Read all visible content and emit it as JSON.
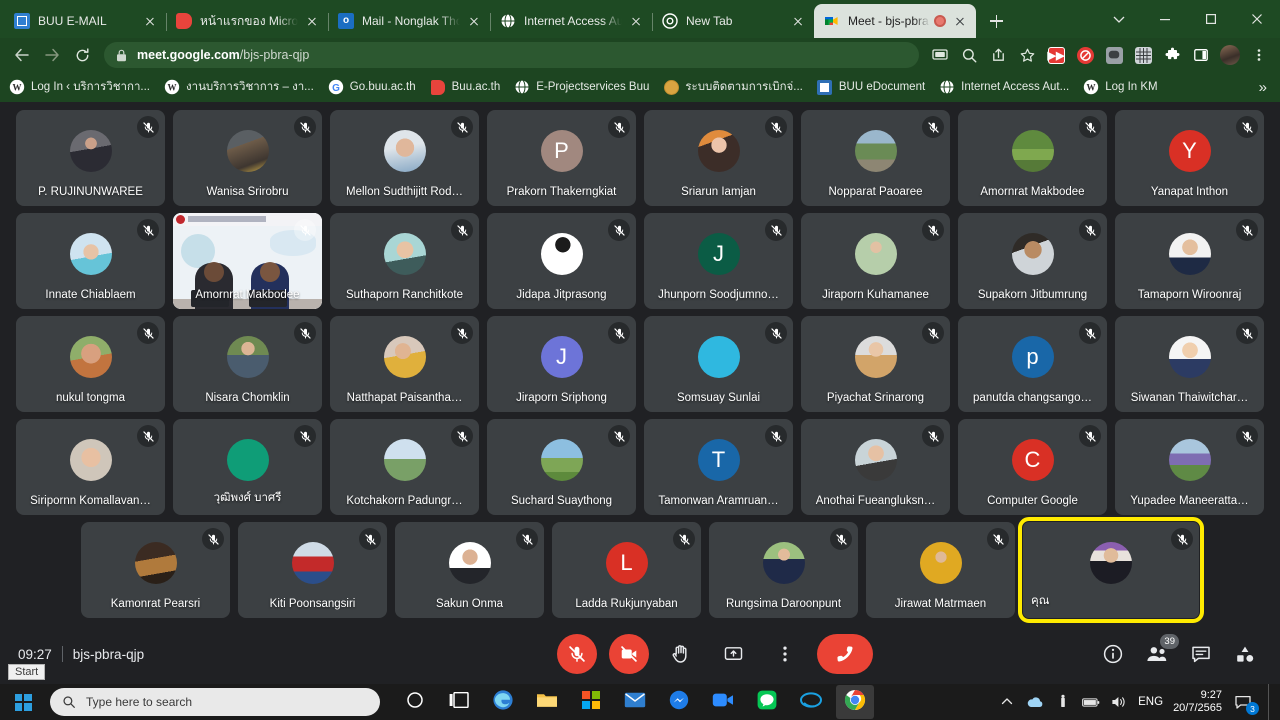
{
  "browser": {
    "tabs": [
      {
        "title": "BUU E-MAIL",
        "favicon": "mail-envelope-icon",
        "favicon_color": "#2f7fd0",
        "active": false,
        "recording": false
      },
      {
        "title": "หน้าแรกของ Microso",
        "favicon": "microsoft-start-icon",
        "favicon_color": "#e8443c",
        "active": false,
        "recording": false
      },
      {
        "title": "Mail - Nonglak Tho",
        "favicon": "outlook-icon",
        "favicon_color": "#1b6ec2",
        "active": false,
        "recording": false
      },
      {
        "title": "Internet Access Aut",
        "favicon": "globe-icon",
        "favicon_color": "#ffffff",
        "active": false,
        "recording": false
      },
      {
        "title": "New Tab",
        "favicon": "chrome-icon",
        "favicon_color": "#ffffff",
        "active": false,
        "recording": false
      },
      {
        "title": "Meet - bjs-pbra",
        "favicon": "google-meet-icon",
        "favicon_color": "#00ac47",
        "active": true,
        "recording": true
      }
    ],
    "new_tab_label": "New tab",
    "window_controls": {
      "minimize": "Minimize",
      "maximize": "Maximize",
      "close": "Close",
      "chevron": "Tab search"
    },
    "nav": {
      "back": "Back",
      "forward": "Forward",
      "reload": "Reload"
    },
    "omnibox": {
      "lock": "site-information-lock-icon",
      "url_domain": "meet.google.com",
      "url_path": "/bjs-pbra-qjp"
    },
    "toolbar_icons": [
      {
        "name": "cast-icon",
        "glyph": "cast"
      },
      {
        "name": "search-icon",
        "glyph": "search"
      },
      {
        "name": "share-icon",
        "glyph": "share"
      },
      {
        "name": "bookmark-star-icon",
        "glyph": "star"
      },
      {
        "name": "extension-video-downloader-icon",
        "glyph": "fwd",
        "color": "#e53935"
      },
      {
        "name": "extension-adblock-icon",
        "glyph": "block",
        "color": "#e53935"
      },
      {
        "name": "extension-line-icon",
        "glyph": "chat",
        "color": "#9aa0a6"
      },
      {
        "name": "extension-grid-icon",
        "glyph": "grid",
        "color": "#9aa0a6"
      },
      {
        "name": "extensions-puzzle-icon",
        "glyph": "puzzle",
        "color": "#ffffff"
      },
      {
        "name": "side-panel-icon",
        "glyph": "panel",
        "color": "#ffffff"
      },
      {
        "name": "profile-avatar",
        "glyph": "avatar"
      },
      {
        "name": "chrome-menu-icon",
        "glyph": "kebab"
      }
    ],
    "bookmarks": [
      {
        "label": "Log In ‹ บริการวิชากา...",
        "icon": "wordpress-icon",
        "color": "#ffffff",
        "text": "W"
      },
      {
        "label": "งานบริการวิชาการ – งา...",
        "icon": "wordpress-icon",
        "color": "#ffffff",
        "text": "W"
      },
      {
        "label": "Go.buu.ac.th",
        "icon": "google-icon",
        "color": "#ffffff",
        "text": "G"
      },
      {
        "label": "Buu.ac.th",
        "icon": "buu-icon",
        "color": "#e8443c",
        "text": ""
      },
      {
        "label": "E-Projectservices Buu",
        "icon": "globe-icon",
        "color": "#ffffff",
        "text": ""
      },
      {
        "label": "ระบบติดตามการเบิกจ่...",
        "icon": "coin-icon",
        "color": "#d9a441",
        "text": ""
      },
      {
        "label": "BUU eDocument",
        "icon": "document-icon",
        "color": "#2f6fb5",
        "text": ""
      },
      {
        "label": "Internet Access Aut...",
        "icon": "globe-icon",
        "color": "#ffffff",
        "text": ""
      },
      {
        "label": "Log In KM",
        "icon": "wordpress-icon",
        "color": "#ffffff",
        "text": "W"
      }
    ],
    "bookmarks_overflow": "»"
  },
  "meet": {
    "rows": [
      [
        {
          "name": "P. RUJINUNWAREE",
          "kind": "photo",
          "photo": "woman-glasses",
          "muted": true
        },
        {
          "name": "Wanisa Srirobru",
          "kind": "photo",
          "photo": "cat",
          "muted": true
        },
        {
          "name": "Mellon Sudthijitt Rod…",
          "kind": "photo",
          "photo": "child-cat-filter",
          "muted": true
        },
        {
          "name": "Prakorn Thakerngkiat",
          "kind": "initial",
          "initial": "P",
          "color": "#a1887f",
          "muted": true
        },
        {
          "name": "Sriarun Iamjan",
          "kind": "photo",
          "photo": "woman-longhair",
          "muted": true
        },
        {
          "name": "Nopparat Paoaree",
          "kind": "photo",
          "photo": "landscape-temple",
          "muted": true
        },
        {
          "name": "Amornrat Makbodee",
          "kind": "photo",
          "photo": "woman-garden",
          "muted": true
        },
        {
          "name": "Yanapat Inthon",
          "kind": "initial",
          "initial": "Y",
          "color": "#d93025",
          "muted": true
        }
      ],
      [
        {
          "name": "Innate Chiablaem",
          "kind": "photo",
          "photo": "baby-sunglasses",
          "muted": true
        },
        {
          "name": "Amornrat Makbodee",
          "kind": "video",
          "muted": true
        },
        {
          "name": "Suthaporn Ranchitkote",
          "kind": "photo",
          "photo": "woman-teal",
          "muted": true
        },
        {
          "name": "Jidapa Jitprasong",
          "kind": "photo",
          "photo": "sketch-portrait",
          "muted": true
        },
        {
          "name": "Jhunporn Soodjumno…",
          "kind": "initial",
          "initial": "J",
          "color": "#0b5c45",
          "muted": true
        },
        {
          "name": "Jiraporn Kuhamanee",
          "kind": "photo",
          "photo": "woman-hijab-green",
          "muted": true
        },
        {
          "name": "Supakorn Jitbumrung",
          "kind": "photo",
          "photo": "man-sunglasses-car",
          "muted": true
        },
        {
          "name": "Tamaporn Wiroonraj",
          "kind": "photo",
          "photo": "woman-suit",
          "muted": true
        }
      ],
      [
        {
          "name": "nukul tongma",
          "kind": "photo",
          "photo": "person-pink-sunglasses",
          "muted": true
        },
        {
          "name": "Nisara Chomklin",
          "kind": "photo",
          "photo": "woman-outdoor",
          "muted": true
        },
        {
          "name": "Natthapat Paisantha…",
          "kind": "photo",
          "photo": "mother-child",
          "muted": true
        },
        {
          "name": "Jiraporn Sriphong",
          "kind": "initial",
          "initial": "J",
          "color": "#6d74d8",
          "muted": true
        },
        {
          "name": "Somsuay Sunlai",
          "kind": "photo",
          "photo": "fu-character-yellow",
          "muted": true
        },
        {
          "name": "Piyachat Srinarong",
          "kind": "photo",
          "photo": "woman-beige-coat",
          "muted": true
        },
        {
          "name": "panutda changsango…",
          "kind": "initial",
          "initial": "p",
          "color": "#1967a8",
          "muted": true
        },
        {
          "name": "Siwanan Thaiwitchar…",
          "kind": "photo",
          "photo": "woman-blonde",
          "muted": true
        }
      ],
      [
        {
          "name": "Siripornn Komallavan…",
          "kind": "photo",
          "photo": "woman-indoor",
          "muted": true
        },
        {
          "name": "วุฒิพงศ์ บาศรี",
          "kind": "photo",
          "photo": "default-person-green",
          "muted": true
        },
        {
          "name": "Kotchakorn Padungr…",
          "kind": "photo",
          "photo": "man-outdoor-wall",
          "muted": true
        },
        {
          "name": "Suchard Suaythong",
          "kind": "photo",
          "photo": "field-landscape",
          "muted": true
        },
        {
          "name": "Tamonwan Aramruan…",
          "kind": "initial",
          "initial": "T",
          "color": "#1967a8",
          "muted": true
        },
        {
          "name": "Anothai Fueangluksn…",
          "kind": "photo",
          "photo": "woman-smiling",
          "muted": true
        },
        {
          "name": "Computer Google",
          "kind": "initial",
          "initial": "C",
          "color": "#d93025",
          "muted": true
        },
        {
          "name": "Yupadee Maneeratta…",
          "kind": "photo",
          "photo": "flower-field",
          "muted": true
        }
      ],
      [
        {
          "name": "Kamonrat Pearsri",
          "kind": "photo",
          "photo": "night-market",
          "muted": true
        },
        {
          "name": "Kiti Poonsangsiri",
          "kind": "photo",
          "photo": "child-redshirt",
          "muted": true
        },
        {
          "name": "Sakun Onma",
          "kind": "photo",
          "photo": "man-portrait",
          "muted": true
        },
        {
          "name": "Ladda Rukjunyaban",
          "kind": "initial",
          "initial": "L",
          "color": "#d93025",
          "muted": true
        },
        {
          "name": "Rungsima Daroonpunt",
          "kind": "photo",
          "photo": "woman-uniform-outdoor",
          "muted": true
        },
        {
          "name": "Jirawat Matrmaen",
          "kind": "photo",
          "photo": "person-cap-yellow",
          "muted": true
        },
        {
          "name": "คุณ",
          "kind": "photo",
          "photo": "woman-academic-gown",
          "muted": true,
          "selfview": true,
          "highlighted": true
        }
      ]
    ],
    "bottombar": {
      "time": "09:27",
      "meeting_code": "bjs-pbra-qjp",
      "controls": [
        {
          "name": "microphone-off-button",
          "state": "muted",
          "danger": true
        },
        {
          "name": "camera-off-button",
          "state": "off",
          "danger": true
        },
        {
          "name": "raise-hand-button",
          "state": "normal",
          "danger": false
        },
        {
          "name": "present-screen-button",
          "state": "normal",
          "danger": false
        },
        {
          "name": "more-options-button",
          "state": "normal",
          "danger": false
        },
        {
          "name": "leave-call-button",
          "state": "hangup",
          "danger": true
        }
      ],
      "right_buttons": [
        {
          "name": "meeting-details-button",
          "badge": ""
        },
        {
          "name": "show-everyone-button",
          "badge": "39"
        },
        {
          "name": "chat-button",
          "badge": ""
        },
        {
          "name": "activities-button",
          "badge": ""
        }
      ]
    },
    "start_tooltip": "Start"
  },
  "taskbar": {
    "start_button": "Start",
    "search_placeholder": "Type here to search",
    "apps": [
      {
        "name": "cortana-icon",
        "color": "#ffffff",
        "text": ""
      },
      {
        "name": "task-view-icon",
        "color": "#ffffff",
        "text": ""
      },
      {
        "name": "microsoft-edge-icon",
        "color": "#25a4e0",
        "text": ""
      },
      {
        "name": "file-explorer-icon",
        "color": "#f5c146",
        "text": ""
      },
      {
        "name": "microsoft-store-icon",
        "color": "#e8443c",
        "text": ""
      },
      {
        "name": "mail-icon",
        "color": "#2f7fd0",
        "text": ""
      },
      {
        "name": "messenger-icon",
        "color": "#1e7ce8",
        "text": ""
      },
      {
        "name": "zoom-icon",
        "color": "#2d8cff",
        "text": ""
      },
      {
        "name": "line-icon",
        "color": "#06c755",
        "text": ""
      },
      {
        "name": "internet-explorer-icon",
        "color": "#1aa1e2",
        "text": ""
      },
      {
        "name": "google-chrome-icon",
        "color": "#ffffff",
        "text": "",
        "active": true
      }
    ],
    "tray": {
      "overflow": "show-hidden-icons-chevron",
      "onedrive": "onedrive-icon",
      "usb": "usb-icon",
      "battery": "battery-icon",
      "volume": "volume-icon",
      "language": "ENG",
      "time": "9:27",
      "date": "20/7/2565",
      "notification_count": "3"
    }
  }
}
